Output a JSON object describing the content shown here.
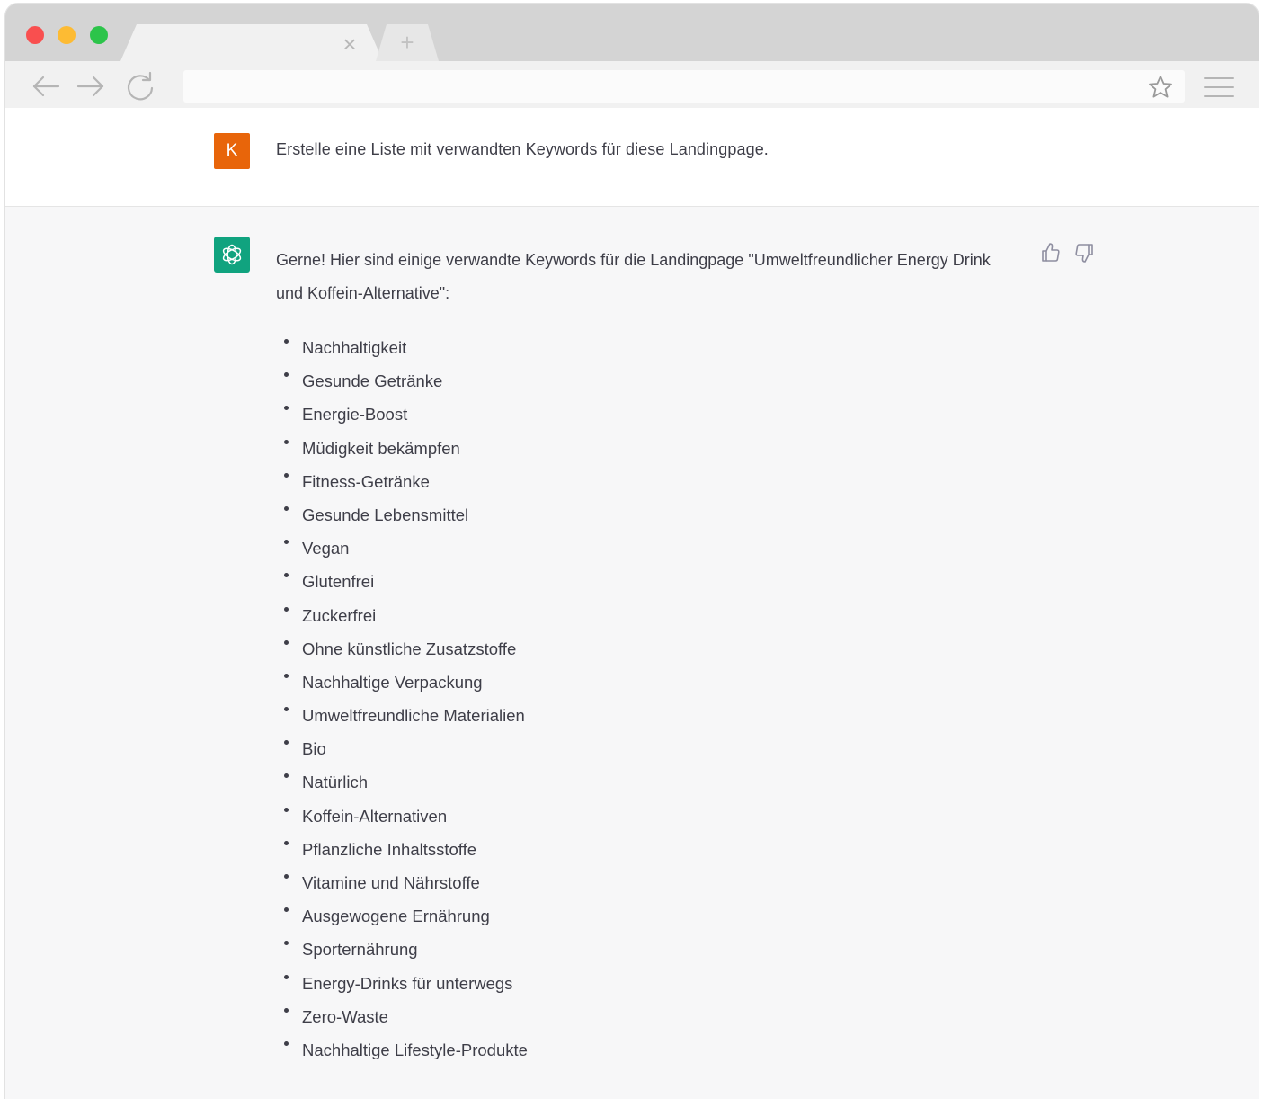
{
  "browser": {
    "tab_close_glyph": "×",
    "new_tab_glyph": "+"
  },
  "chat": {
    "user": {
      "avatar_initial": "K",
      "avatar_color": "#e8650a",
      "message": "Erstelle eine Liste mit verwandten Keywords für diese Landingpage."
    },
    "assistant": {
      "avatar_color": "#10a37f",
      "intro": "Gerne! Hier sind einige verwandte Keywords für die Landingpage \"Umweltfreundlicher Energy Drink und Koffein-Alternative\":",
      "keywords": [
        "Nachhaltigkeit",
        "Gesunde Getränke",
        "Energie-Boost",
        "Müdigkeit bekämpfen",
        "Fitness-Getränke",
        "Gesunde Lebensmittel",
        "Vegan",
        "Glutenfrei",
        "Zuckerfrei",
        "Ohne künstliche Zusatzstoffe",
        "Nachhaltige Verpackung",
        "Umweltfreundliche Materialien",
        "Bio",
        "Natürlich",
        "Koffein-Alternativen",
        "Pflanzliche Inhaltsstoffe",
        "Vitamine und Nährstoffe",
        "Ausgewogene Ernährung",
        "Sporternährung",
        "Energy-Drinks für unterwegs",
        "Zero-Waste",
        "Nachhaltige Lifestyle-Produkte"
      ]
    }
  },
  "icons": {
    "back": "arrow-left-icon",
    "forward": "arrow-right-icon",
    "reload": "reload-icon",
    "bookmark": "star-icon",
    "menu": "hamburger-menu-icon",
    "thumbs_up": "thumbs-up-icon",
    "thumbs_down": "thumbs-down-icon"
  }
}
